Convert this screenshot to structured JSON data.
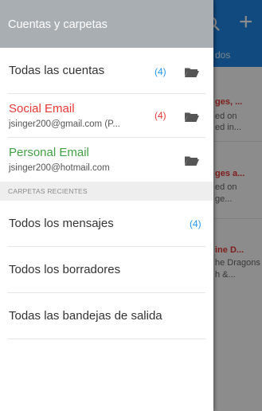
{
  "drawer": {
    "header": "Cuentas y carpetas",
    "accounts": [
      {
        "name": "Todas las cuentas",
        "email": "",
        "count": "(4)",
        "name_color": "#333333"
      },
      {
        "name": "Social Email",
        "email": "jsinger200@gmail.com (P...",
        "count": "(4)",
        "name_color": "#e53935"
      },
      {
        "name": "Personal Email",
        "email": "jsinger200@hotmail.com",
        "count": "",
        "name_color": "#43a047"
      }
    ],
    "recent_section": "CARPETAS RECIENTES",
    "recent": [
      {
        "label": "Todos los mensajes",
        "count": "(4)"
      },
      {
        "label": "Todos los borradores",
        "count": ""
      },
      {
        "label": "Todas las bandejas de salida",
        "count": ""
      }
    ]
  },
  "background": {
    "tab_text": "dos",
    "lines": [
      {
        "text": "ges, ...",
        "red": true
      },
      {
        "text": "ed on",
        "red": false
      },
      {
        "text": "ed in...",
        "red": false
      },
      {
        "text": "ges a...",
        "red": true
      },
      {
        "text": "ed on",
        "red": false
      },
      {
        "text": "ge...",
        "red": false
      },
      {
        "text": "ine D...",
        "red": true
      },
      {
        "text": "he Dragons",
        "red": false
      },
      {
        "text": "h &...",
        "red": false
      }
    ]
  },
  "colors": {
    "accent": "#2196f3",
    "header_bg": "#a9aeb3",
    "app_bar": "#1e88e5",
    "social": "#e53935",
    "personal": "#43a047"
  }
}
